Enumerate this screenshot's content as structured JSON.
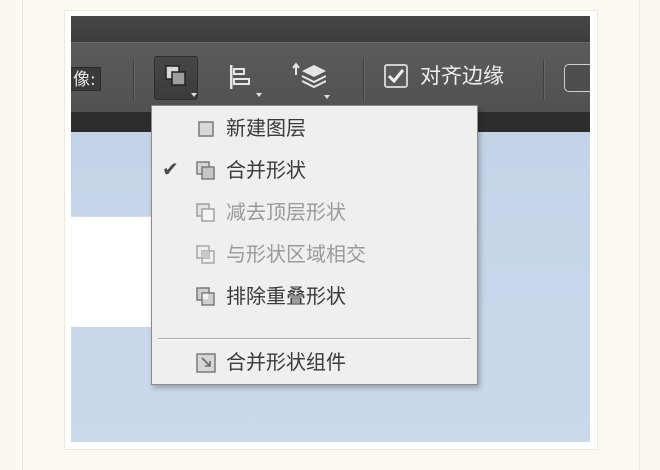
{
  "toolbar": {
    "partial_field_label": "像:",
    "snap_label": "对齐边缘",
    "snap_checked": true
  },
  "menu": {
    "items": [
      {
        "label": "新建图层",
        "icon": "new-layer-icon",
        "checked": false,
        "disabled": false
      },
      {
        "label": "合并形状",
        "icon": "combine-shapes-icon",
        "checked": true,
        "disabled": false
      },
      {
        "label": "减去顶层形状",
        "icon": "subtract-front-shape-icon",
        "checked": false,
        "disabled": true
      },
      {
        "label": "与形状区域相交",
        "icon": "intersect-shape-areas-icon",
        "checked": false,
        "disabled": true
      },
      {
        "label": "排除重叠形状",
        "icon": "exclude-overlapping-shapes-icon",
        "checked": false,
        "disabled": false
      }
    ],
    "footer_item": {
      "label": "合并形状组件",
      "icon": "merge-shape-components-icon",
      "disabled": false
    }
  },
  "colors": {
    "options_bar": "#555555",
    "canvas_bg": "#c7d7ea",
    "menu_bg": "#efefef",
    "menu_text": "#3a3a3a",
    "menu_text_disabled": "#9a9a9a"
  }
}
